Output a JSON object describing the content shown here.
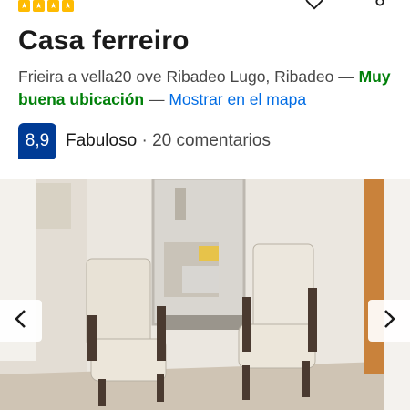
{
  "header": {
    "star_count": 4,
    "icons": [
      "star-box-icon",
      "heart-icon",
      "share-icon"
    ]
  },
  "property": {
    "name": "Casa ferreiro",
    "address": "Frieira a vella20 ove Ribadeo Lugo, Ribadeo",
    "dash1": " — ",
    "location_label": "Muy buena ubicación",
    "dash2": " — ",
    "map_link": "Mostrar en el mapa"
  },
  "rating": {
    "score": "8,9",
    "word": "Fabuloso",
    "separator": " · ",
    "reviews": "20 comentarios"
  },
  "gallery": {
    "prev_icon": "chevron-left-icon",
    "next_icon": "chevron-right-icon"
  },
  "colors": {
    "star": "#febb02",
    "score_bg": "#003b95",
    "good_location": "#008009",
    "link": "#006ce4"
  }
}
